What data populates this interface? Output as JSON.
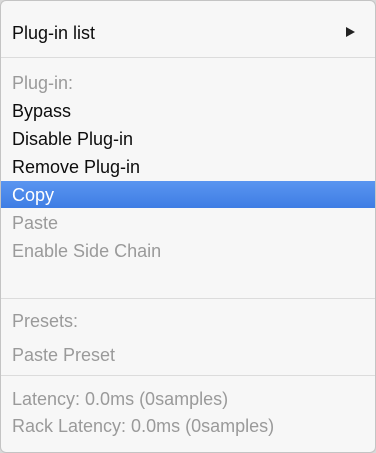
{
  "menu": {
    "plugin_list": "Plug-in list",
    "plugin_section": "Plug-in:",
    "bypass": "Bypass",
    "disable_plugin": "Disable Plug-in",
    "remove_plugin": "Remove Plug-in",
    "copy": "Copy",
    "paste": "Paste",
    "enable_side_chain": "Enable Side Chain",
    "presets_section": "Presets:",
    "paste_preset": "Paste Preset",
    "latency": "Latency: 0.0ms (0samples)",
    "rack_latency": "Rack Latency: 0.0ms (0samples)"
  },
  "icons": {
    "submenu_arrow": "submenu-arrow-icon"
  },
  "colors": {
    "highlight": "#4a87ea",
    "disabled_text": "#9a9a9a",
    "enabled_text": "#0d0d0d"
  }
}
